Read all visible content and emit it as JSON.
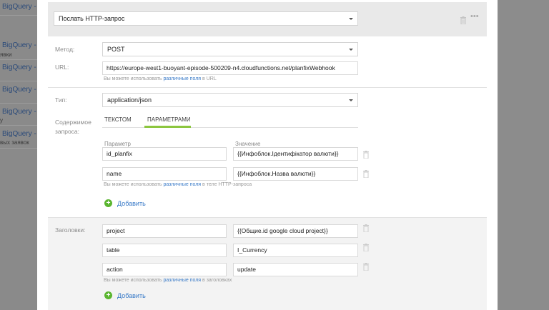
{
  "background_list": [
    {
      "title": "BigQuery -",
      "sub": ""
    },
    {
      "title": "BigQuery -",
      "sub": "явки"
    },
    {
      "title": "BigQuery -",
      "sub": ""
    },
    {
      "title": "BigQuery -",
      "sub": ""
    },
    {
      "title": "BigQuery -",
      "sub": "у"
    },
    {
      "title": "BigQuery -",
      "sub": "вых заявок"
    }
  ],
  "action_select": {
    "value": "Послать HTTP-запрос"
  },
  "method": {
    "label": "Метод:",
    "value": "POST"
  },
  "url": {
    "label": "URL:",
    "value": "https://europe-west1-buoyant-episode-500209-n4.cloudfunctions.net/planfixWebhook",
    "hint_prefix": "Вы можете использовать",
    "hint_link": "различные поля",
    "hint_suffix": "в URL"
  },
  "type": {
    "label": "Тип:",
    "value": "application/json"
  },
  "body": {
    "label": "Содержимое запроса:",
    "tabs": [
      "ТЕКСТОМ",
      "ПАРАМЕТРАМИ"
    ],
    "col_param": "Параметр",
    "col_value": "Значение",
    "rows": [
      {
        "param": "id_planfix",
        "value": "{{Инфоблок.Ідентифікатор валюти}}"
      },
      {
        "param": "name",
        "value": "{{Инфоблок.Назва валюти}}"
      }
    ],
    "hint_prefix": "Вы можете использовать",
    "hint_link": "различные поля",
    "hint_suffix": "в теле HTTP-запроса",
    "add_label": "Добавить"
  },
  "headers": {
    "label": "Заголовки:",
    "rows": [
      {
        "param": "project",
        "value": "{{Общие.id google cloud project}}"
      },
      {
        "param": "table",
        "value": "I_Currency"
      },
      {
        "param": "action",
        "value": "update"
      }
    ],
    "hint_prefix": "Вы можете использовать",
    "hint_link": "различные поля",
    "hint_suffix": "в заголовках",
    "add_label": "Добавить"
  },
  "colors": {
    "accent": "#8cc63f",
    "link": "#3a7bc8",
    "add": "#5ab52f"
  },
  "icons": [
    "trash-icon",
    "more-dots-icon",
    "chevron-down-icon",
    "plus-circle-icon"
  ]
}
